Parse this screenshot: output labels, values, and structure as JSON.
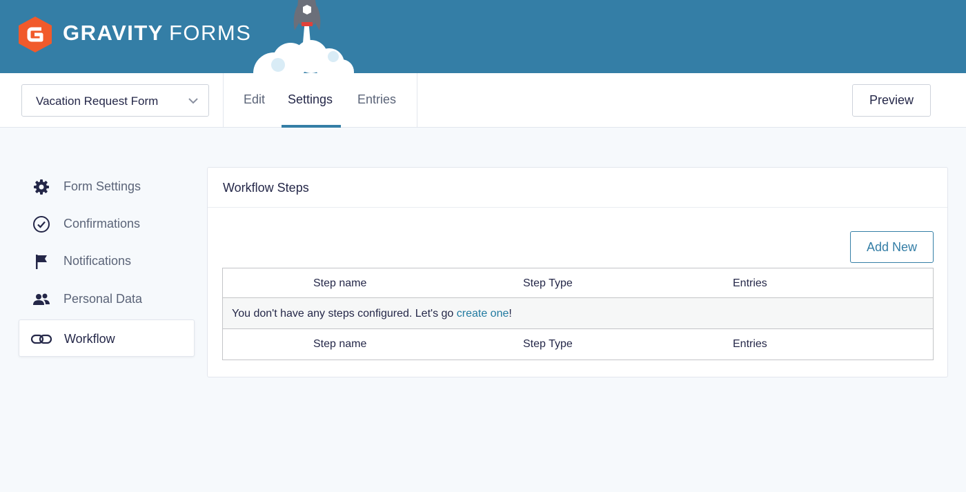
{
  "brand": {
    "name_bold": "GRAVITY",
    "name_light": "FORMS"
  },
  "toolbar": {
    "form_select": {
      "value": "Vacation Request Form"
    },
    "tabs": [
      {
        "label": "Edit",
        "active": false
      },
      {
        "label": "Settings",
        "active": true
      },
      {
        "label": "Entries",
        "active": false
      }
    ],
    "preview_label": "Preview"
  },
  "sidebar": {
    "items": [
      {
        "label": "Form Settings",
        "icon": "gear-icon",
        "active": false
      },
      {
        "label": "Confirmations",
        "icon": "check-circle-icon",
        "active": false
      },
      {
        "label": "Notifications",
        "icon": "flag-icon",
        "active": false
      },
      {
        "label": "Personal Data",
        "icon": "people-icon",
        "active": false
      },
      {
        "label": "Workflow",
        "icon": "workflow-icon",
        "active": true
      }
    ]
  },
  "panel": {
    "title": "Workflow Steps",
    "add_new_label": "Add New",
    "table": {
      "columns": [
        "Step name",
        "Step Type",
        "Entries"
      ],
      "empty_message_prefix": "You don't have any steps configured. Let's go ",
      "empty_message_link": "create one",
      "empty_message_suffix": "!"
    }
  },
  "colors": {
    "header": "#347ea6",
    "accent": "#347ea6",
    "logo": "#f15a2b",
    "link": "#217aa0"
  }
}
